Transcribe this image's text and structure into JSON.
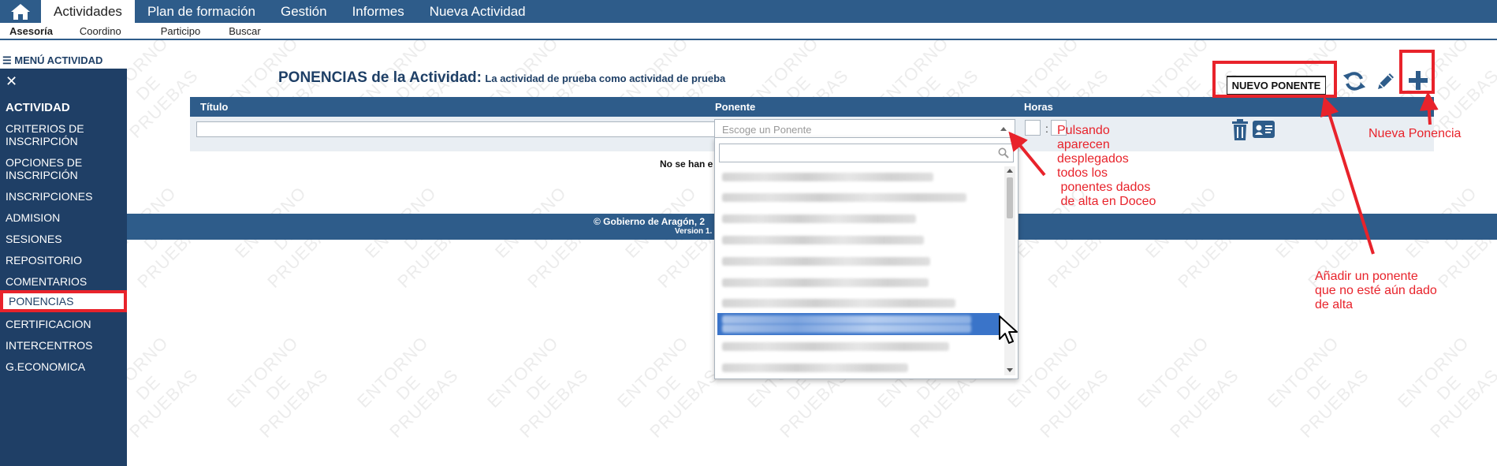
{
  "topnav": {
    "items": [
      "Actividades",
      "Plan de formación",
      "Gestión",
      "Informes",
      "Nueva Actividad"
    ],
    "active_index": 0
  },
  "subnav": {
    "items": [
      "Asesoría",
      "Coordino",
      "Participo",
      "Buscar"
    ],
    "active_index": 0
  },
  "sidebar": {
    "menu_title": "☰ MENÚ ACTIVIDAD",
    "close_glyph": "✕",
    "section": "ACTIVIDAD",
    "items": [
      "CRITERIOS DE\nINSCRIPCIÓN",
      "OPCIONES DE\nINSCRIPCIÓN",
      "INSCRIPCIONES",
      "ADMISION",
      "SESIONES",
      "REPOSITORIO",
      "COMENTARIOS",
      "PONENCIAS",
      "CERTIFICACION",
      "INTERCENTROS",
      "G.ECONOMICA"
    ],
    "selected": "PONENCIAS"
  },
  "main": {
    "heading": "PONENCIAS de la Actividad:",
    "subheading": "La actividad de prueba como actividad de prueba",
    "nuevo_ponente_label": "NUEVO PONENTE",
    "table": {
      "columns": [
        "Título",
        "Ponente",
        "Horas"
      ]
    },
    "empty_message": "No se han e",
    "select": {
      "placeholder": "Escoge un Ponente",
      "search_value": ""
    }
  },
  "footer": {
    "text": "© Gobierno de Aragón, 2",
    "version": "Version 1."
  },
  "annotations": {
    "dropdown_note": "Pulsando\naparecen\ndesplegados\ntodos los\n ponentes dados\n de alta en Doceo",
    "nueva_ponencia": "Nueva Ponencia",
    "add_ponente_note": "Añadir un ponente\nque no esté aún dado\nde alta"
  },
  "watermark": [
    "ENTORNO",
    "DE",
    "PRUEBAS"
  ],
  "colors": {
    "nav_blue": "#2e5c8a",
    "sidebar_blue": "#1f3f66",
    "annotation_red": "#e8232b",
    "highlight_blue": "#3a74c9"
  },
  "icons": [
    "home-icon",
    "refresh-icon",
    "pencil-icon",
    "plus-icon",
    "trash-icon",
    "id-card-icon",
    "search-icon",
    "mouse-cursor-icon"
  ]
}
